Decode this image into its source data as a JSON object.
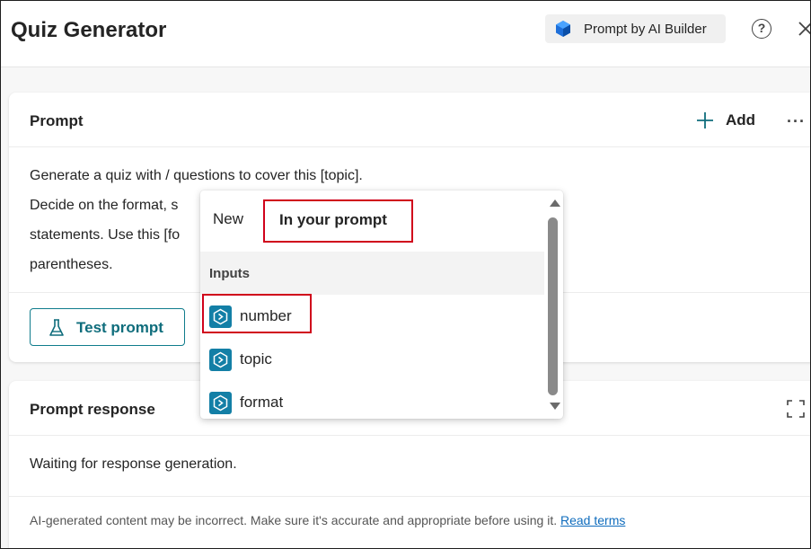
{
  "header": {
    "title": "Quiz Generator",
    "badge_label": "Prompt by AI Builder",
    "help_glyph": "?",
    "icons": [
      "ai-builder-logo-icon",
      "help-icon",
      "close-icon"
    ]
  },
  "prompt_card": {
    "title": "Prompt",
    "add_label": "Add",
    "more_glyph": "···",
    "lines": [
      "Generate a quiz with     / questions to cover this [topic].",
      "Decide on the format, s",
      "statements. Use this [fo",
      "parentheses."
    ],
    "test_button_label": "Test prompt"
  },
  "popup": {
    "tab_new": "New",
    "tab_in_prompt": "In your prompt",
    "section_header": "Inputs",
    "items": [
      "number",
      "topic",
      "format"
    ]
  },
  "response_card": {
    "title": "Prompt response",
    "status": "Waiting for response generation.",
    "disclaimer": "AI-generated content may be incorrect. Make sure it's accurate and appropriate before using it.",
    "read_terms_link": "Read terms"
  },
  "colors": {
    "accent_teal": "#0f7c8c",
    "input_icon_blue": "#137fa6",
    "highlight_red": "#d0021b",
    "link_blue": "#0f6cbd"
  }
}
